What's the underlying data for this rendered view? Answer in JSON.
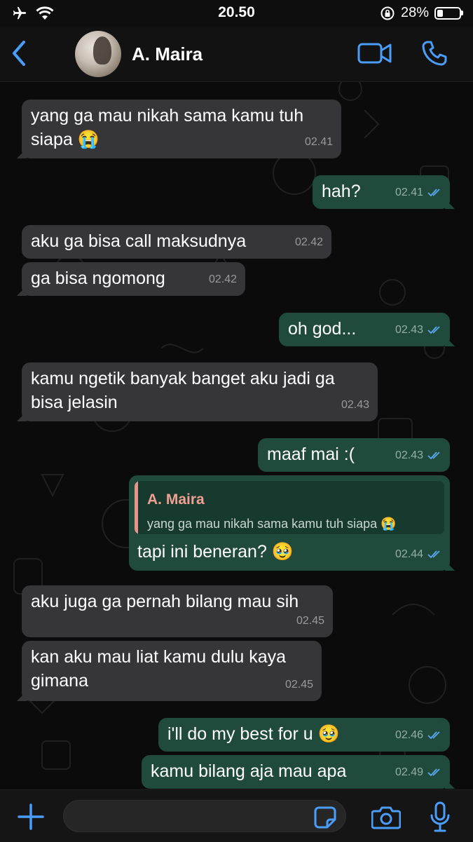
{
  "status_bar": {
    "time": "20.50",
    "battery": "28%",
    "battery_level": 0.28
  },
  "header": {
    "contact_name": "A. Maira",
    "icons": [
      "back-chevron-icon",
      "video-call-icon",
      "phone-icon"
    ]
  },
  "messages": [
    {
      "dir": "in",
      "text": "yang ga mau nikah sama kamu tuh\nsiapa 😭",
      "time": "02.41"
    },
    {
      "dir": "out",
      "text": "hah?",
      "time": "02.41",
      "read": true
    },
    {
      "dir": "in",
      "text": "aku ga bisa call maksudnya",
      "time": "02.42"
    },
    {
      "dir": "in",
      "text": "ga bisa ngomong",
      "time": "02.42"
    },
    {
      "dir": "out",
      "text": "oh god...",
      "time": "02.43",
      "read": true
    },
    {
      "dir": "in",
      "text": "kamu ngetik banyak banget aku jadi ga\nbisa jelasin",
      "time": "02.43"
    },
    {
      "dir": "out",
      "text": "maaf mai :(",
      "time": "02.43",
      "read": true
    },
    {
      "dir": "out",
      "text": "tapi ini beneran? 🥹",
      "time": "02.44",
      "read": true,
      "reply": {
        "author": "A. Maira",
        "text": "yang ga mau nikah sama kamu tuh siapa 😭"
      }
    },
    {
      "dir": "in",
      "text": "aku juga ga pernah bilang mau sih",
      "time": "02.45"
    },
    {
      "dir": "in",
      "text": "kan aku mau liat kamu dulu kaya\ngimana",
      "time": "02.45"
    },
    {
      "dir": "out",
      "text": "i'll do my best for u 🥹",
      "time": "02.46",
      "read": true
    },
    {
      "dir": "out",
      "text": "kamu bilang aja mau apa",
      "time": "02.49",
      "read": true
    }
  ],
  "input_bar": {
    "placeholder": "",
    "icons": [
      "plus-icon",
      "sticker-icon",
      "camera-icon",
      "microphone-icon"
    ]
  },
  "colors": {
    "incoming_bubble": "#363638",
    "outgoing_bubble": "#1f4a3c",
    "accent": "#4a9df8",
    "reply_author": "#f0a090"
  }
}
